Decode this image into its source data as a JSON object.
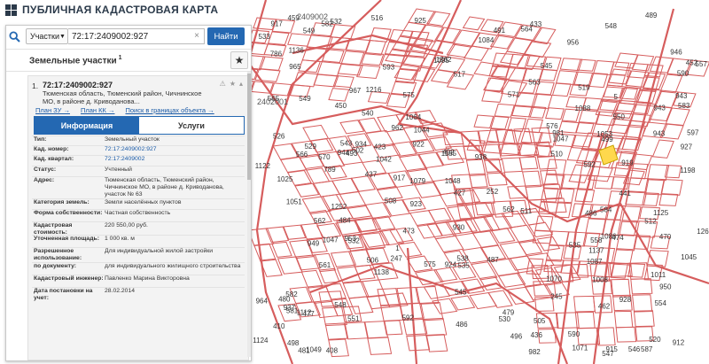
{
  "app": {
    "title": "ПУБЛИЧНАЯ КАДАСТРОВАЯ КАРТА"
  },
  "search": {
    "type_label": "Участки",
    "query": "72:17:2409002:927",
    "button_label": "Найти",
    "clear_symbol": "×"
  },
  "section": {
    "title": "Земельные участки",
    "count": "1"
  },
  "result": {
    "index": "1.",
    "cad_number": "72:17:2409002:927",
    "address_short": "Тюменская область, Тюменский район, Чичнинское МО, в районе д. Криводанова...",
    "links": [
      "План ЗУ →",
      "План КК →",
      "Поиск в границах объекта →"
    ]
  },
  "tabs": {
    "info": "Информация",
    "services": "Услуги"
  },
  "info_rows": [
    {
      "label": "Тип:",
      "value": "Земельный участок"
    },
    {
      "label": "Кад. номер:",
      "value": "72:17:2409002:927"
    },
    {
      "label": "Кад. квартал:",
      "value": "72:17:2409002"
    },
    {
      "label": "Статус:",
      "value": "Учтенный"
    },
    {
      "label": "Адрес:",
      "value": "Тюменская область, Тюменский район, Чичнинское МО, в районе д. Криводанова, участок № 63"
    },
    {
      "label": "Категория земель:",
      "value": "Земли населённых пунктов"
    },
    {
      "label": "Форма собственности:",
      "value": "Частная собственность"
    },
    {
      "label": "Кадастровая стоимость:",
      "value": "220 550,00 руб."
    },
    {
      "label": "Уточненная площадь:",
      "value": "1 000 кв. м"
    },
    {
      "label": "Разрешенное использование:",
      "value": "Для индивидуальной жилой застройки"
    },
    {
      "label": "по документу:",
      "value": "для индивидуального жилищного строительства"
    },
    {
      "label": "Кадастровый инженер:",
      "value": "Павленко Марина Викторовна"
    },
    {
      "label": "Дата постановки на учет:",
      "value": "28.02.2014"
    }
  ],
  "map": {
    "parcel_labels": [
      "930",
      "493",
      "582",
      "584",
      "587",
      "593",
      "924",
      "508",
      "247",
      "592",
      "919",
      "491",
      "917",
      "915",
      "917",
      "245",
      "252",
      "597",
      "590",
      "922",
      "546",
      "502",
      "505",
      "506",
      "928",
      "510",
      "530",
      "582",
      "5",
      "480",
      "1",
      "575",
      "477",
      "1011",
      "519",
      "526",
      "529",
      "532",
      "484",
      "592",
      "1025",
      "520",
      "512",
      "590",
      "535",
      "581",
      "538",
      "540",
      "516",
      "545",
      "496",
      "499",
      "511",
      "548",
      "583",
      "576",
      "551",
      "549",
      "561",
      "548",
      "564",
      "1062",
      "565",
      "486",
      "462",
      "566",
      "489",
      "571",
      "535",
      "473",
      "562",
      "543",
      "545",
      "550",
      "554",
      "479",
      "470",
      "570",
      "557",
      "547",
      "1042",
      "498",
      "558",
      "563",
      "1047",
      "408",
      "1084",
      "562",
      "1064",
      "423",
      "433",
      "436",
      "437",
      "1047",
      "575",
      "1086",
      "410",
      "441",
      "450",
      "459",
      "1095",
      "474",
      "481",
      "492",
      "452",
      "517",
      "532",
      "533",
      "486",
      "549",
      "1138",
      "427",
      "1048",
      "1051",
      "1053",
      "487",
      "1008",
      "1087",
      "1088",
      "1070",
      "1071",
      "1079",
      "1112",
      "1122",
      "1137",
      "1185",
      "1198",
      "1216",
      "1045",
      "943",
      "944",
      "786",
      "789",
      "1125",
      "1124",
      "1136",
      "956",
      "1252",
      "1269",
      "943",
      "943",
      "934",
      "927",
      "938",
      "949",
      "937",
      "962",
      "964",
      "982",
      "981",
      "967",
      "946",
      "950",
      "965",
      "923",
      "925",
      "912",
      "953",
      "1044",
      "1049"
    ],
    "area_labels": [
      "2402001",
      "2409002"
    ],
    "colors": {
      "line": "#d65d5d",
      "selected": "#ffd84d",
      "accent": "#2468b2"
    }
  }
}
